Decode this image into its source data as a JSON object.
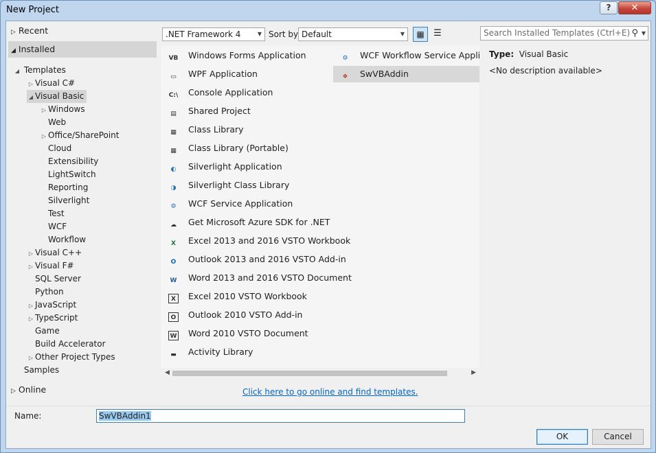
{
  "window": {
    "title": "New Project",
    "help_label": "?",
    "close_label": "✕"
  },
  "tree": {
    "recent": "Recent",
    "installed": "Installed",
    "templates": "Templates",
    "items": [
      {
        "label": "Visual C#",
        "level": 1,
        "arrow": "▷"
      },
      {
        "label": "Visual Basic",
        "level": 1,
        "arrow": "◢",
        "selected": true
      },
      {
        "label": "Windows",
        "level": 2,
        "arrow": "▷"
      },
      {
        "label": "Web",
        "level": 2,
        "arrow": ""
      },
      {
        "label": "Office/SharePoint",
        "level": 2,
        "arrow": "▷"
      },
      {
        "label": "Cloud",
        "level": 2,
        "arrow": ""
      },
      {
        "label": "Extensibility",
        "level": 2,
        "arrow": ""
      },
      {
        "label": "LightSwitch",
        "level": 2,
        "arrow": ""
      },
      {
        "label": "Reporting",
        "level": 2,
        "arrow": ""
      },
      {
        "label": "Silverlight",
        "level": 2,
        "arrow": ""
      },
      {
        "label": "Test",
        "level": 2,
        "arrow": ""
      },
      {
        "label": "WCF",
        "level": 2,
        "arrow": ""
      },
      {
        "label": "Workflow",
        "level": 2,
        "arrow": ""
      },
      {
        "label": "Visual C++",
        "level": 1,
        "arrow": "▷"
      },
      {
        "label": "Visual F#",
        "level": 1,
        "arrow": "▷"
      },
      {
        "label": "SQL Server",
        "level": 1,
        "arrow": ""
      },
      {
        "label": "Python",
        "level": 1,
        "arrow": ""
      },
      {
        "label": "JavaScript",
        "level": 1,
        "arrow": "▷"
      },
      {
        "label": "TypeScript",
        "level": 1,
        "arrow": "▷"
      },
      {
        "label": "Game",
        "level": 1,
        "arrow": ""
      },
      {
        "label": "Build Accelerator",
        "level": 1,
        "arrow": ""
      },
      {
        "label": "Other Project Types",
        "level": 1,
        "arrow": "▷"
      }
    ],
    "samples": "Samples",
    "online": "Online"
  },
  "toolbar": {
    "framework": ".NET Framework 4",
    "sort_by_label": "Sort by:",
    "sort_by_value": "Default",
    "search_placeholder": "Search Installed Templates (Ctrl+E)"
  },
  "templates_left": [
    {
      "label": "Windows Forms Application",
      "icon": "vb-form-icon",
      "glyph": "VB"
    },
    {
      "label": "WPF Application",
      "icon": "wpf-window-icon",
      "glyph": "▭"
    },
    {
      "label": "Console Application",
      "icon": "console-icon",
      "glyph": "C:\\"
    },
    {
      "label": "Shared Project",
      "icon": "shared-project-icon",
      "glyph": "▤"
    },
    {
      "label": "Class Library",
      "icon": "class-library-icon",
      "glyph": "▦"
    },
    {
      "label": "Class Library (Portable)",
      "icon": "portable-library-icon",
      "glyph": "▦"
    },
    {
      "label": "Silverlight Application",
      "icon": "silverlight-icon",
      "glyph": "◐"
    },
    {
      "label": "Silverlight Class Library",
      "icon": "silverlight-library-icon",
      "glyph": "◑"
    },
    {
      "label": "WCF Service Application",
      "icon": "wcf-gear-icon",
      "glyph": "⚙"
    },
    {
      "label": "Get Microsoft Azure SDK for .NET",
      "icon": "cloud-icon",
      "glyph": "☁"
    },
    {
      "label": "Excel 2013 and 2016 VSTO Workbook",
      "icon": "excel-icon",
      "glyph": "X"
    },
    {
      "label": "Outlook 2013 and 2016 VSTO Add-in",
      "icon": "outlook-icon",
      "glyph": "O"
    },
    {
      "label": "Word 2013 and 2016 VSTO Document",
      "icon": "word-icon",
      "glyph": "W"
    },
    {
      "label": "Excel 2010 VSTO Workbook",
      "icon": "excel-2010-icon",
      "glyph": "X"
    },
    {
      "label": "Outlook 2010 VSTO Add-in",
      "icon": "outlook-2010-icon",
      "glyph": "O"
    },
    {
      "label": "Word 2010 VSTO Document",
      "icon": "word-2010-icon",
      "glyph": "W"
    },
    {
      "label": "Activity Library",
      "icon": "activity-library-icon",
      "glyph": "▬"
    }
  ],
  "templates_right": [
    {
      "label": "WCF Workflow Service Applicatic",
      "icon": "wcf-workflow-icon",
      "glyph": "⚙"
    },
    {
      "label": "SwVBAddin",
      "icon": "addin-box-icon",
      "glyph": "❖",
      "selected": true
    }
  ],
  "description": {
    "type_label": "Type:",
    "type_value": "Visual Basic",
    "none": "<No description available>"
  },
  "online_link": "Click here to go online and find templates.",
  "name": {
    "label": "Name:",
    "value": "SwVBAddin1"
  },
  "buttons": {
    "ok": "OK",
    "cancel": "Cancel"
  },
  "colors": {
    "link": "#0066cc",
    "selection": "#d8d8d8",
    "name_highlight": "#99c9ef",
    "excel": "#1f7244",
    "outlook": "#0a64b8",
    "word": "#2b579a"
  }
}
